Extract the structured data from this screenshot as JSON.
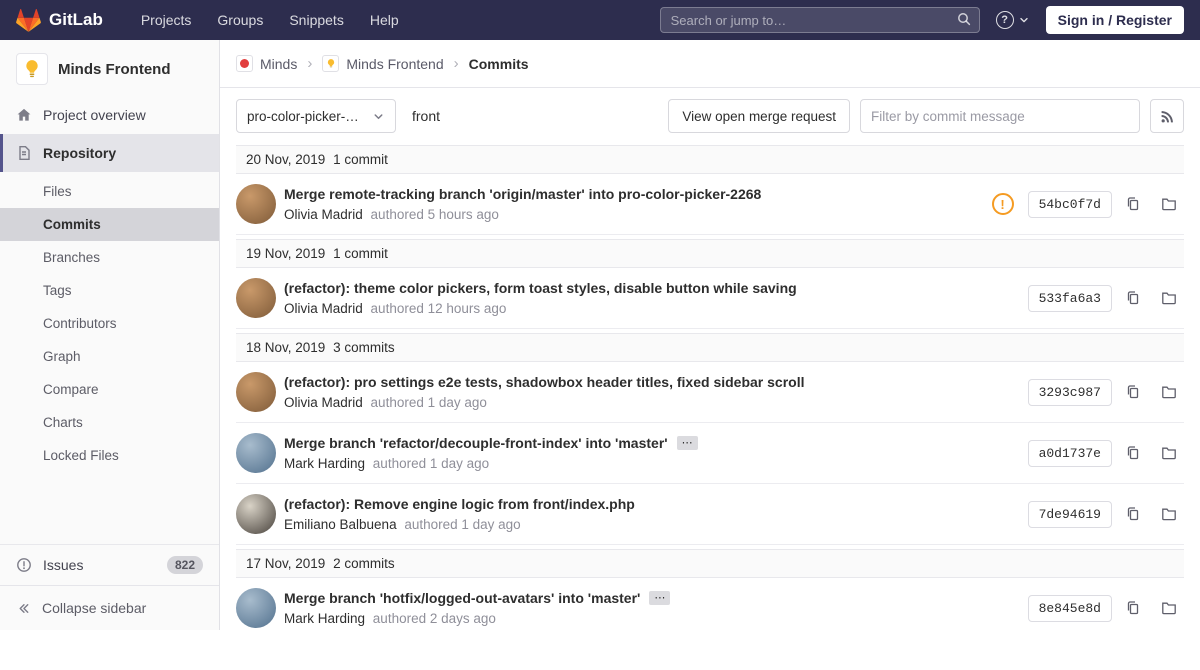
{
  "theme": {
    "navbar_bg": "#2d2d4e",
    "brand_orange": "#fc6d26",
    "link_blue": "#1b69b6",
    "warning_orange": "#f59b22",
    "sidebar_bg": "#fafafa",
    "active_item_bg": "#d4d4d9"
  },
  "icons": {
    "separator": "›",
    "help": "?",
    "expand_dots": "⋯",
    "warning_glyph": "!"
  },
  "navbar": {
    "brand": "GitLab",
    "menu": [
      "Projects",
      "Groups",
      "Snippets",
      "Help"
    ],
    "search_placeholder": "Search or jump to…",
    "sign_in": "Sign in / Register"
  },
  "sidebar": {
    "project_name": "Minds Frontend",
    "overview": "Project overview",
    "repository": "Repository",
    "sub": [
      "Files",
      "Commits",
      "Branches",
      "Tags",
      "Contributors",
      "Graph",
      "Compare",
      "Charts",
      "Locked Files"
    ],
    "issues": "Issues",
    "issues_count": "822",
    "collapse": "Collapse sidebar"
  },
  "breadcrumb": {
    "items": [
      "Minds",
      "Minds Frontend",
      "Commits"
    ]
  },
  "controls": {
    "branch": "pro-color-picker-…",
    "path": "front",
    "merge_button": "View open merge request",
    "filter_placeholder": "Filter by commit message"
  },
  "commits": {
    "groups": [
      {
        "date": "20 Nov, 2019",
        "count": "1 commit",
        "commits": [
          {
            "title": "Merge remote-tracking branch 'origin/master' into pro-color-picker-2268",
            "author": "Olivia Madrid",
            "authored": "authored 5 hours ago",
            "sha": "54bc0f7d",
            "warning": true,
            "expand": false,
            "avatar": {
              "c1": "#c9996a",
              "c2": "#7e5a38"
            }
          }
        ]
      },
      {
        "date": "19 Nov, 2019",
        "count": "1 commit",
        "commits": [
          {
            "title": "(refactor): theme color pickers, form toast styles, disable button while saving",
            "author": "Olivia Madrid",
            "authored": "authored 12 hours ago",
            "sha": "533fa6a3",
            "warning": false,
            "expand": false,
            "avatar": {
              "c1": "#c9996a",
              "c2": "#7e5a38"
            }
          }
        ]
      },
      {
        "date": "18 Nov, 2019",
        "count": "3 commits",
        "commits": [
          {
            "title": "(refactor): pro settings e2e tests, shadowbox header titles, fixed sidebar scroll",
            "author": "Olivia Madrid",
            "authored": "authored 1 day ago",
            "sha": "3293c987",
            "warning": false,
            "expand": false,
            "avatar": {
              "c1": "#c9996a",
              "c2": "#7e5a38"
            }
          },
          {
            "title": "Merge branch 'refactor/decouple-front-index' into 'master'",
            "author": "Mark Harding",
            "authored": "authored 1 day ago",
            "sha": "a0d1737e",
            "warning": false,
            "expand": true,
            "avatar": {
              "c1": "#a8bccd",
              "c2": "#51708d"
            }
          },
          {
            "title": "(refactor): Remove engine logic from front/index.php",
            "author": "Emiliano Balbuena",
            "authored": "authored 1 day ago",
            "sha": "7de94619",
            "warning": false,
            "expand": false,
            "avatar": {
              "c1": "#d9d3c7",
              "c2": "#46403a"
            }
          }
        ]
      },
      {
        "date": "17 Nov, 2019",
        "count": "2 commits",
        "commits": [
          {
            "title": "Merge branch 'hotfix/logged-out-avatars' into 'master'",
            "author": "Mark Harding",
            "authored": "authored 2 days ago",
            "sha": "8e845e8d",
            "warning": false,
            "expand": true,
            "avatar": {
              "c1": "#a8bccd",
              "c2": "#51708d"
            }
          }
        ]
      }
    ]
  }
}
